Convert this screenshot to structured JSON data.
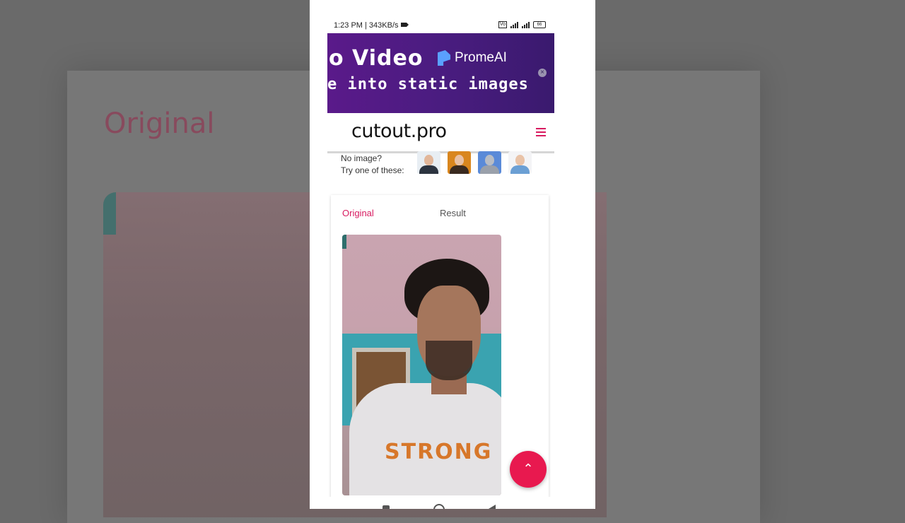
{
  "background": {
    "title": "Original"
  },
  "status_bar": {
    "time_speed": "1:23 PM | 343KB/s",
    "battery": "66"
  },
  "ad": {
    "line1": "o Video",
    "brand": "PromeAI",
    "line2": "e into static images",
    "close_symbol": "×"
  },
  "header": {
    "logo": "cutout.pro",
    "menu_icon": "hamburger-menu-icon"
  },
  "samples": {
    "line1": "No image?",
    "line2": "Try one of these:",
    "thumbnails": [
      "man-in-suit",
      "woman-portrait",
      "statue",
      "baby"
    ]
  },
  "card": {
    "tabs": [
      {
        "label": "Original",
        "active": true
      },
      {
        "label": "Result",
        "active": false
      }
    ],
    "shirt_print": "STRONG"
  },
  "fab": {
    "icon": "chevron-up-icon",
    "symbol": "⌃"
  },
  "colors": {
    "accent": "#d81b60",
    "fab": "#e8194f",
    "ad_bg": "#4a1c80"
  }
}
